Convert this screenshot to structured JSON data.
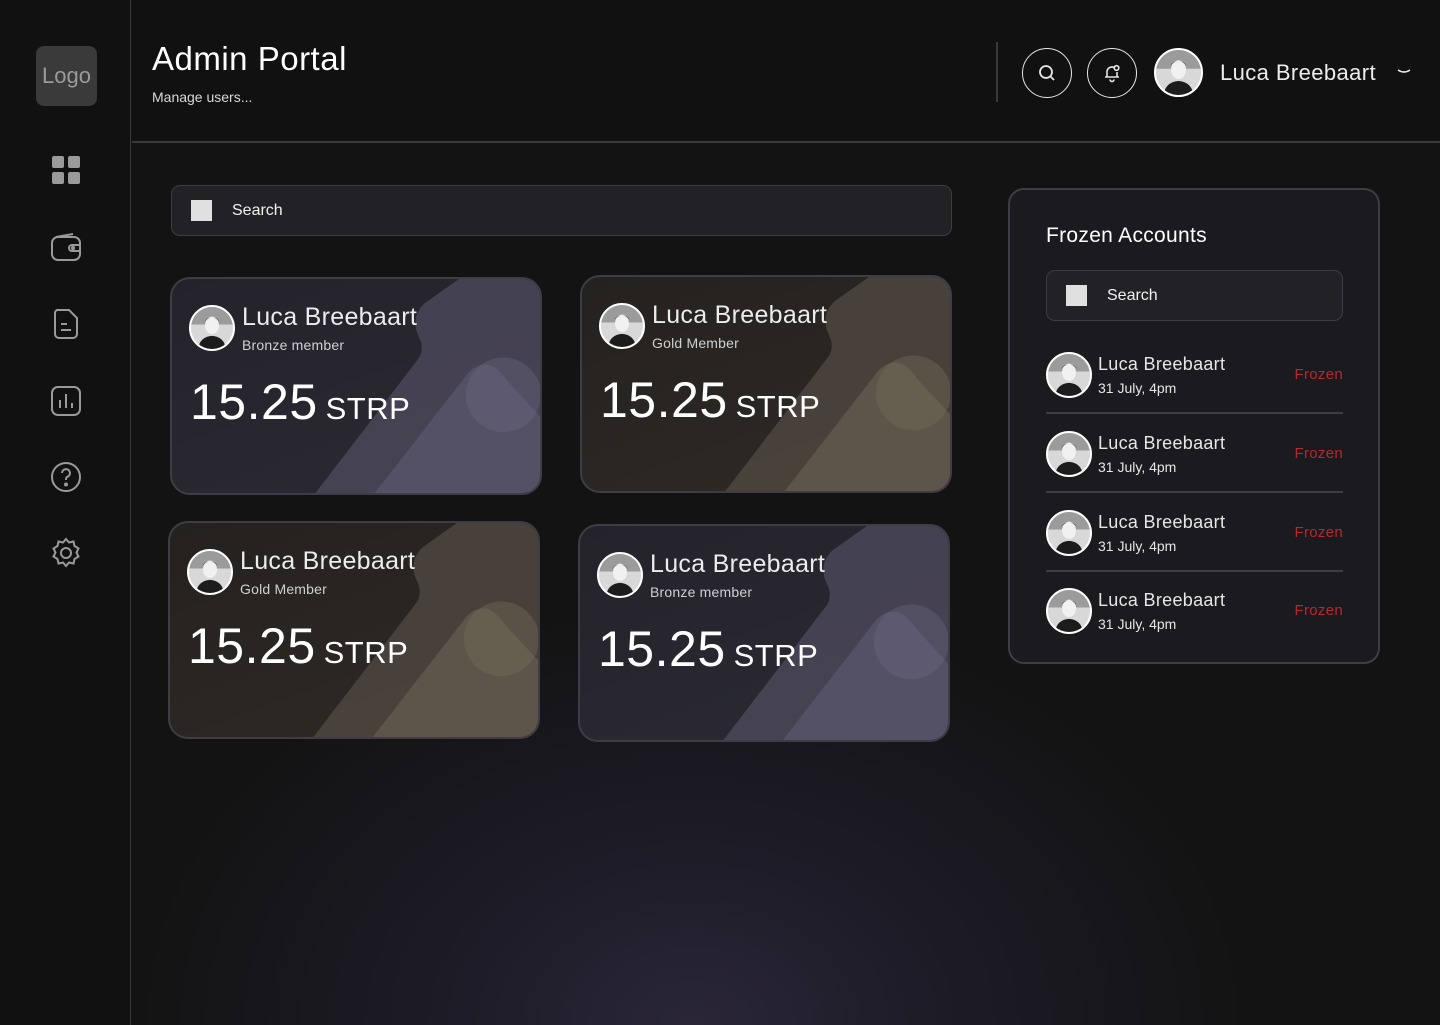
{
  "sidebar": {
    "logo": "Logo",
    "items": [
      {
        "icon": "dashboard-icon"
      },
      {
        "icon": "wallet-icon"
      },
      {
        "icon": "document-icon"
      },
      {
        "icon": "chart-icon"
      },
      {
        "icon": "help-icon"
      },
      {
        "icon": "settings-icon"
      }
    ]
  },
  "header": {
    "title": "Admin Portal",
    "subtitle": "Manage users...",
    "user_name": "Luca Breebaart"
  },
  "main": {
    "search_placeholder": "Search",
    "cards": [
      {
        "name": "Luca Breebaart",
        "tier": "Bronze member",
        "amount": "15.25",
        "unit": "STRP",
        "theme": "bronze"
      },
      {
        "name": "Luca Breebaart",
        "tier": "Gold Member",
        "amount": "15.25",
        "unit": "STRP",
        "theme": "gold"
      },
      {
        "name": "Luca Breebaart",
        "tier": "Gold Member",
        "amount": "15.25",
        "unit": "STRP",
        "theme": "gold"
      },
      {
        "name": "Luca Breebaart",
        "tier": "Bronze member",
        "amount": "15.25",
        "unit": "STRP",
        "theme": "bronze"
      }
    ]
  },
  "frozen": {
    "title": "Frozen Accounts",
    "search_placeholder": "Search",
    "rows": [
      {
        "name": "Luca Breebaart",
        "date": "31 July, 4pm",
        "status": "Frozen"
      },
      {
        "name": "Luca Breebaart",
        "date": "31 July, 4pm",
        "status": "Frozen"
      },
      {
        "name": "Luca Breebaart",
        "date": "31 July, 4pm",
        "status": "Frozen"
      },
      {
        "name": "Luca Breebaart",
        "date": "31 July, 4pm",
        "status": "Frozen"
      }
    ]
  },
  "colors": {
    "frozen_status": "#b8282c",
    "bronze_accent": "#5a5670",
    "gold_accent": "#6b6152"
  }
}
